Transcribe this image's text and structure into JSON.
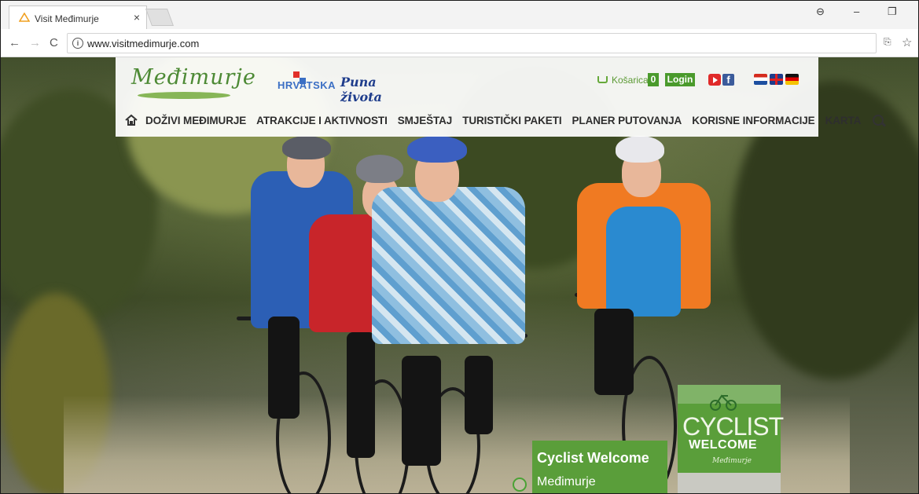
{
  "browser": {
    "tab_title": "Visit Međimurje",
    "tab_close": "×",
    "url": "www.visitmedimurje.com",
    "info_glyph": "i",
    "back_glyph": "←",
    "forward_glyph": "→",
    "reload_glyph": "C",
    "profile_glyph": "⊖",
    "minimize_glyph": "–",
    "restore_glyph": "❐",
    "translate_glyph": "⎘",
    "star_glyph": "☆"
  },
  "header": {
    "logo_text": "Međimurje",
    "hr_text": "HRVATSKA",
    "hr_tagline": "Puna života",
    "cart_label": "Košarica",
    "cart_count": "0",
    "login_label": "Login",
    "fb_glyph": "f"
  },
  "nav": {
    "items": [
      "DOŽIVI MEĐIMURJE",
      "ATRAKCIJE I AKTIVNOSTI",
      "SMJEŠTAJ",
      "TURISTIČKI PAKETI",
      "PLANER PUTOVANJA",
      "KORISNE INFORMACIJE",
      "KARTA"
    ]
  },
  "badge": {
    "line1": "CYCLIST",
    "line2": "WELCOME",
    "line3": "Međimurje"
  },
  "slide": {
    "title": "Cyclist Welcome",
    "subtitle": "Međimurje"
  },
  "colors": {
    "brand_green": "#4a9a2c",
    "logo_green": "#4d8a35",
    "youtube_red": "#e02a2a",
    "facebook_blue": "#3b5b9b"
  }
}
